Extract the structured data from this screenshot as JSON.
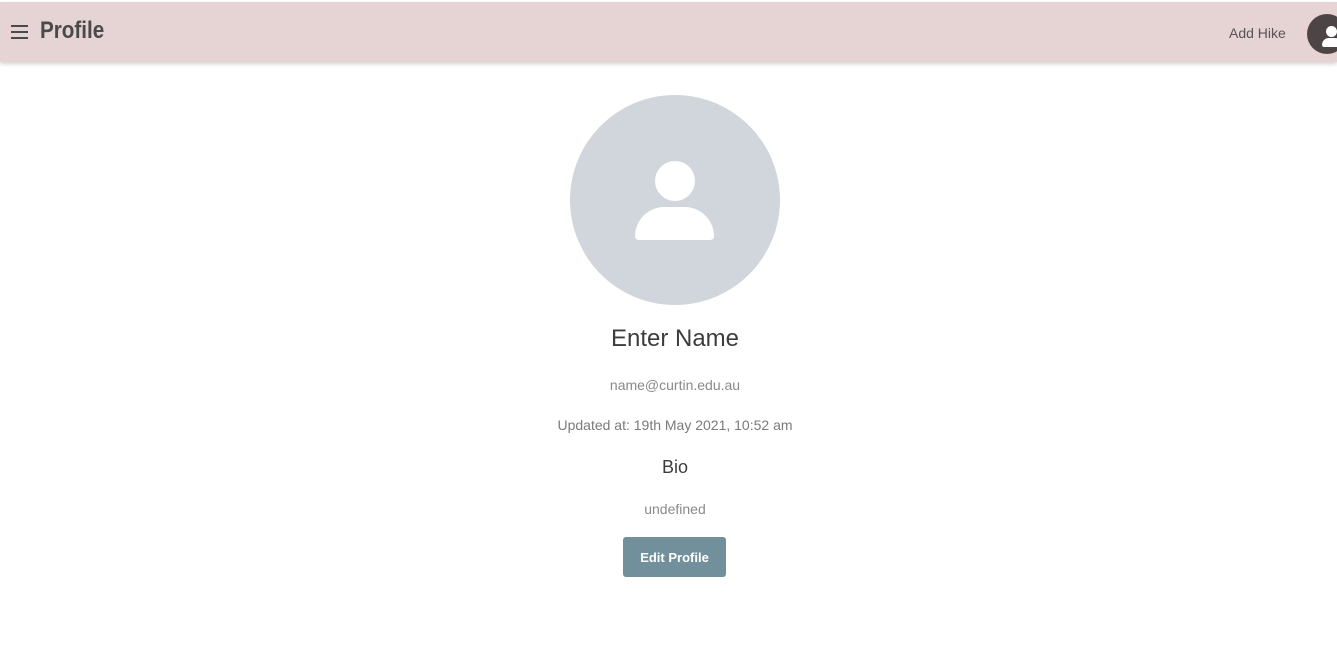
{
  "header": {
    "title": "Profile",
    "menu_icon": "hamburger-menu-icon",
    "add_hike_label": "Add Hike",
    "account_icon": "account-icon"
  },
  "profile": {
    "avatar_icon": "person-icon",
    "name": "Enter Name",
    "email": "name@curtin.edu.au",
    "updated_at": "Updated at: 19th May 2021, 10:52 am",
    "bio_heading": "Bio",
    "bio": "undefined",
    "edit_button_label": "Edit Profile"
  },
  "colors": {
    "header_bg": "#e6d3d3",
    "avatar_bg": "#d1d5dc",
    "button_bg": "#71909c",
    "account_bg": "#4d4545"
  }
}
